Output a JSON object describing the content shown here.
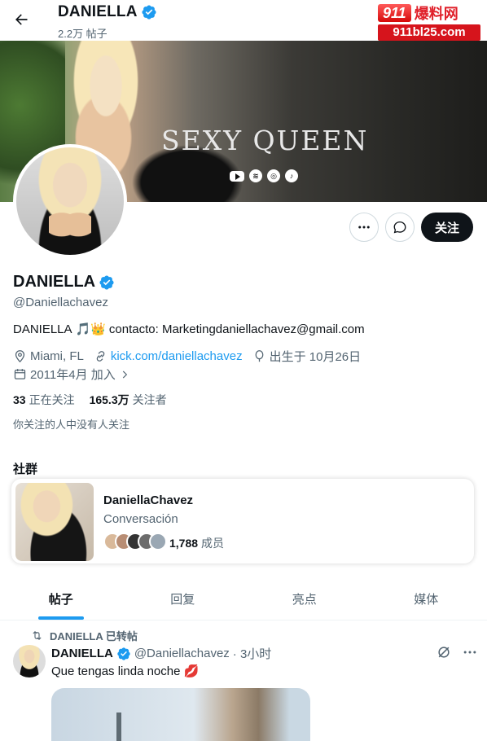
{
  "header": {
    "title": "DANIELLA",
    "post_count": "2.2万 帖子"
  },
  "watermark": {
    "logo_num": "911",
    "logo_text": "爆料网",
    "url": "911bl25.com"
  },
  "banner": {
    "title": "SEXY QUEEN",
    "social_icons": [
      "youtube-icon",
      "spotify-icon",
      "instagram-icon",
      "tiktok-icon"
    ]
  },
  "actions": {
    "more_label": "···",
    "follow_label": "关注"
  },
  "profile": {
    "name": "DANIELLA",
    "handle": "@Daniellachavez",
    "bio_name": "DANIELLA",
    "bio_emojis": "🎵👑",
    "bio_text": "contacto: Marketingdaniellachavez@gmail.com",
    "location": "Miami, FL",
    "website": "kick.com/daniellachavez",
    "birthday": "出生于 10月26日",
    "joined": "2011年4月 加入",
    "following_count": "33",
    "following_label": "正在关注",
    "followers_count": "165.3万",
    "followers_label": "关注者",
    "mutuals_text": "你关注的人中没有人关注"
  },
  "community_section": {
    "title": "社群",
    "name": "DaniellaChavez",
    "subtitle": "Conversación",
    "member_count": "1,788",
    "member_label": "成员"
  },
  "tabs": [
    {
      "label": "帖子",
      "active": true
    },
    {
      "label": "回复",
      "active": false
    },
    {
      "label": "亮点",
      "active": false
    },
    {
      "label": "媒体",
      "active": false
    }
  ],
  "post": {
    "repost_label": "DANIELLA 已转帖",
    "author_name": "DANIELLA",
    "author_handle": "@Daniellachavez",
    "time": "· 3小时",
    "text": "Que tengas linda noche",
    "text_emoji": "💋"
  },
  "colors": {
    "accent": "#1d9bf0",
    "text": "#0f1419",
    "secondary": "#536471"
  }
}
